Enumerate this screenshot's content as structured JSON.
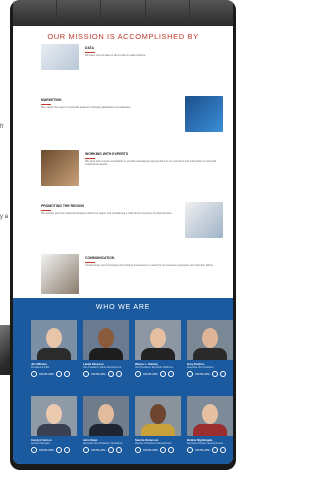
{
  "mission": {
    "title": "OUR MISSION IS ACCOMPLISHED BY",
    "sections": [
      {
        "heading": "DATA",
        "text": "We keep current data on all Contact in-state practice."
      },
      {
        "heading": "MARKETING",
        "text": "We market the region to potential audience through publications and websites."
      },
      {
        "heading": "WORKING WITH EXPERTS",
        "text": "We work with experts consultants to provide educational opportunities to our members and information to potential industrial prospects."
      },
      {
        "heading": "PROMOTING THE REGION",
        "text": "We actively promote industrial locations within the region and maintaining a wide brand inventory of potential sites."
      },
      {
        "heading": "COMMUNICATION",
        "text": "Continuously communicating with existing businesses to maximize our business expansion and retention efforts."
      }
    ]
  },
  "team": {
    "title": "WHO WE ARE",
    "members": [
      {
        "name": "Jim Dillman",
        "role": "President & CEO",
        "phone": "336.681.2680"
      },
      {
        "name": "Lakita Simpson",
        "role": "Vice President, Admin Development",
        "phone": "336.681.2654"
      },
      {
        "name": "Wayne L. Stanley",
        "role": "Vice President, Economic Platforms",
        "phone": "336.681.2651"
      },
      {
        "name": "Gary Perkins",
        "role": "Executive Vice President",
        "phone": "336.681.2653"
      },
      {
        "name": "Carolyn Vernon",
        "role": "Account Manager",
        "phone": "336.681.2659"
      },
      {
        "name": "John Dean",
        "role": "Executive Vice President, Operations",
        "phone": "336.681.2651"
      },
      {
        "name": "Sandra Roberson",
        "role": "Director of Business Development",
        "phone": "336.681.2658"
      },
      {
        "name": "Bobbie Nightingale",
        "role": "Executive Director, Economic Dev.",
        "phone": "336.681.2660"
      }
    ]
  },
  "background": {
    "fragment1": "fr",
    "fragment2": "y a"
  },
  "colors": {
    "accent": "#c0392b",
    "team_bg": "#1c5aa0"
  }
}
